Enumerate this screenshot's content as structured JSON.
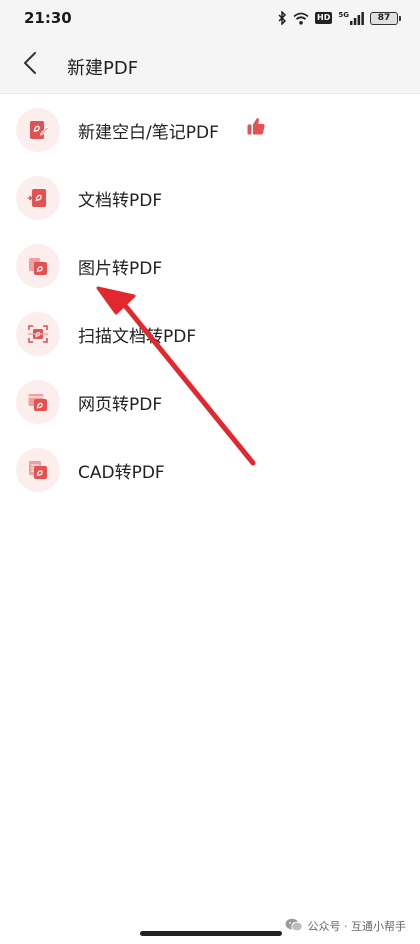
{
  "status_bar": {
    "time": "21:30",
    "network": "5G",
    "hd_badge": "HD",
    "battery": "87",
    "icons": [
      "bluetooth-icon",
      "wifi-icon",
      "hd-icon",
      "signal-icon",
      "battery-icon"
    ]
  },
  "header": {
    "title": "新建PDF",
    "back_icon": "chevron-left-icon"
  },
  "menu": {
    "items": [
      {
        "label": "新建空白/笔记PDF",
        "icon": "pdf-note-icon",
        "badge_icon": "thumbs-up-icon"
      },
      {
        "label": "文档转PDF",
        "icon": "doc-to-pdf-icon"
      },
      {
        "label": "图片转PDF",
        "icon": "image-to-pdf-icon"
      },
      {
        "label": "扫描文档转PDF",
        "icon": "scan-to-pdf-icon"
      },
      {
        "label": "网页转PDF",
        "icon": "web-to-pdf-icon"
      },
      {
        "label": "CAD转PDF",
        "icon": "cad-to-pdf-icon"
      }
    ]
  },
  "annotation": {
    "type": "red-arrow",
    "points_to": "图片转PDF",
    "color": "#e0282e"
  },
  "watermark": {
    "text": "公众号 · 互通小帮手",
    "icon": "wechat-icon"
  },
  "colors": {
    "accent": "#e25250",
    "icon_bg": "#fdeeee",
    "header_bg": "#f5f5f5"
  }
}
